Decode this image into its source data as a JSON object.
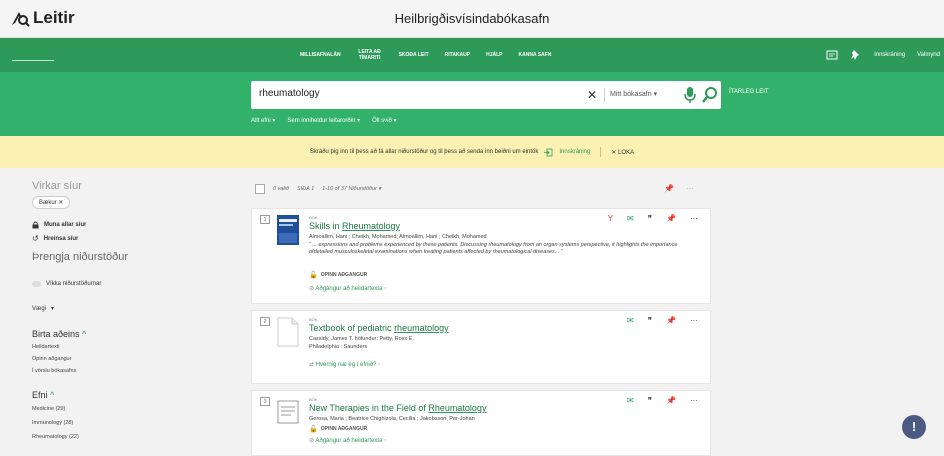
{
  "app": {
    "logo_text": "Leitir",
    "site_title": "Heilbrigðisvísindabókasafn"
  },
  "nav": {
    "items": [
      {
        "label": "MILLISAFNALÁN"
      },
      {
        "label": "LEITA AÐ TÍMARITI"
      },
      {
        "label": "SKOÐA LEIT"
      },
      {
        "label": "RITAKAUP"
      },
      {
        "label": "HJÁLP"
      },
      {
        "label": "KANNA SAFN"
      }
    ],
    "login": "Innskráning",
    "menu": "Valmynd"
  },
  "search": {
    "query": "rheumatology",
    "scope": "Mitt bókasafn",
    "advanced": "ÍTARLEG LEIT",
    "filters": [
      "Allt efni",
      "Sem inniheldur leitarorðin",
      "Öll svið"
    ]
  },
  "notice": {
    "text": "Skráðu þig inn til þess að fá allar niðurstöður og til þess að senda inn beiðni um eintök",
    "login": "Innskráning",
    "close": "LOKA"
  },
  "sidebar": {
    "active_filters_title": "Virkar síur",
    "chip": "Bækur",
    "remember": "Muna allar síur",
    "reset": "Hreinsa síur",
    "narrow_title": "Þrengja niðurstöður",
    "expand_toggle": "Víkka niðurstöðurnar",
    "sort": "Vægi",
    "show_only_title": "Birta aðeins",
    "show_only": [
      "Heildartexti",
      "Opinn aðgangur",
      "Í vörslu bókasafns"
    ],
    "subject_title": "Efni",
    "subjects": [
      "Medicine (29)",
      "Immunology (28)",
      "Rheumatology (22)"
    ]
  },
  "results": {
    "selected": "0 valið",
    "page": "SÍÐA 1",
    "range": "1-10 of 37 Niðurstöður",
    "items": [
      {
        "num": "1",
        "type": "BÓK",
        "title_pre": "Skills in ",
        "title_hl": "Rheumatology",
        "title_post": "",
        "authors": "Almoallim, Hani ; Cheikh, Mohamed; Almoallim, Hani ; Cheikh, Mohamed",
        "snippet": "“ ... expressions and problems experienced by these patients. Discussing rheumatology from an organ systems perspective, it highlights the importance ofdetailed musculoskeletal examinations when treating patients affected by rheumatological diseases... ”",
        "oa": "OPINN AÐGANGUR",
        "link": "Aðgangur að heildartexta"
      },
      {
        "num": "2",
        "type": "BÓK",
        "title_pre": "Textbook of pediatric ",
        "title_hl": "rheumatology",
        "title_post": "",
        "authors": "Cassidy, James T. höfundur; Petty, Ross E.",
        "publisher": "Philadelphia : Saunders",
        "link": "Hvernig næ ég í efnið?"
      },
      {
        "num": "3",
        "type": "BÓK",
        "title_pre": "New Therapies in the Field of ",
        "title_hl": "Rheumatology",
        "title_post": "",
        "authors": "Gerosa, Maria ; Beatrice Chighizola, Cecilia ; Jakobsson, Per-Johan",
        "oa": "OPINN AÐGANGUR",
        "link": "Aðgangur að heildartexta"
      }
    ]
  },
  "help": {
    "label": "!"
  },
  "colors": {
    "primary": "#2e9a5a",
    "search_band": "#32b16a",
    "notice_bg": "#fbf1b2"
  }
}
